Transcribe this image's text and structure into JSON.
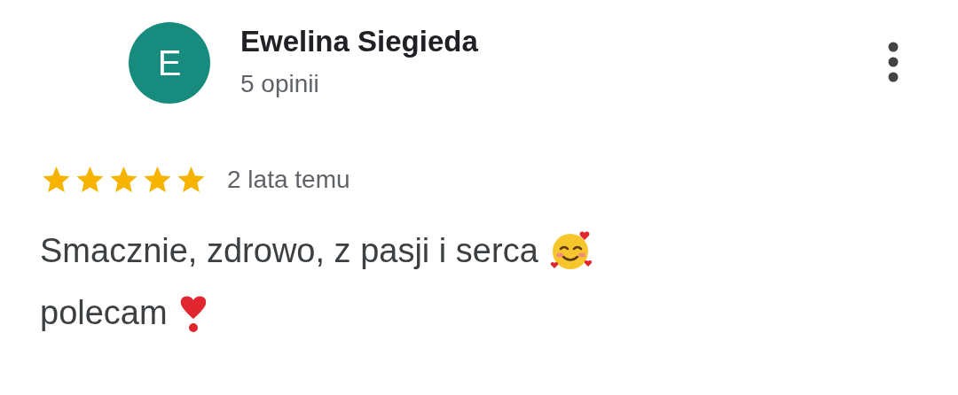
{
  "reviewer": {
    "initial": "E",
    "name": "Ewelina Siegieda",
    "reviews_count": "5 opinii"
  },
  "review": {
    "stars": 5,
    "time": "2 lata temu",
    "lines": [
      {
        "text": "Smacznie, zdrowo, z pasji i serca",
        "kind": "smiling-hearts"
      },
      {
        "text": "polecam",
        "kind": "heart-exclamation"
      }
    ]
  }
}
